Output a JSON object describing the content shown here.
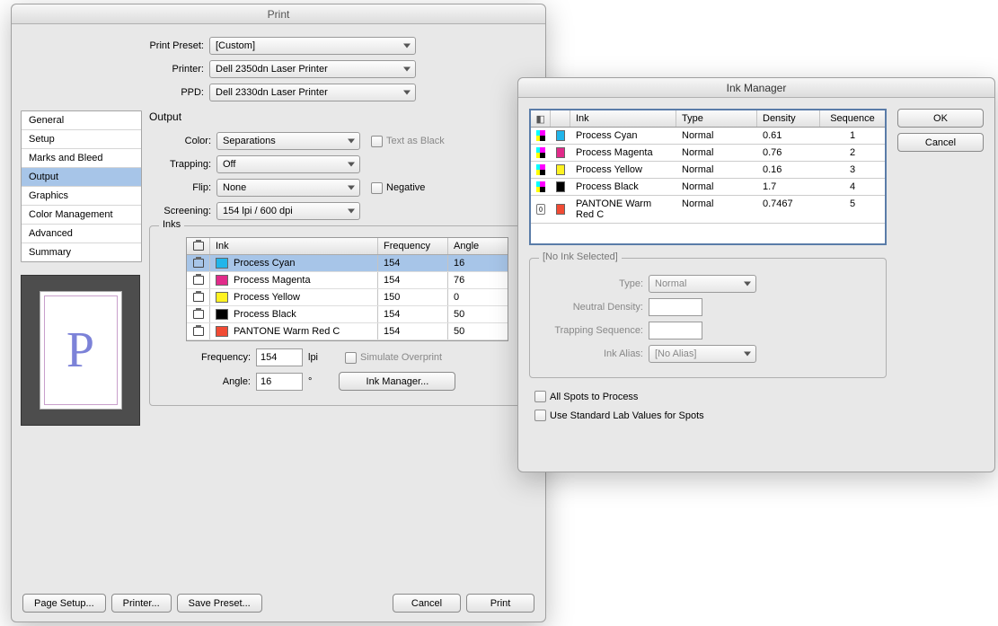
{
  "print": {
    "title": "Print",
    "preset_label": "Print Preset:",
    "preset_value": "[Custom]",
    "printer_label": "Printer:",
    "printer_value": "Dell 2350dn Laser Printer",
    "ppd_label": "PPD:",
    "ppd_value": "Dell 2330dn Laser Printer",
    "sidebar": [
      "General",
      "Setup",
      "Marks and Bleed",
      "Output",
      "Graphics",
      "Color Management",
      "Advanced",
      "Summary"
    ],
    "selected_index": 3,
    "section_title": "Output",
    "color_label": "Color:",
    "color_value": "Separations",
    "text_as_black": "Text as Black",
    "trapping_label": "Trapping:",
    "trapping_value": "Off",
    "flip_label": "Flip:",
    "flip_value": "None",
    "negative_label": "Negative",
    "screening_label": "Screening:",
    "screening_value": "154 lpi / 600 dpi",
    "inks_legend": "Inks",
    "headers": {
      "ink": "Ink",
      "freq": "Frequency",
      "angle": "Angle"
    },
    "rows": [
      {
        "name": "Process Cyan",
        "swatch": "#21b5ea",
        "freq": "154",
        "angle": "16",
        "selected": true
      },
      {
        "name": "Process Magenta",
        "swatch": "#e12b8a",
        "freq": "154",
        "angle": "76",
        "selected": false
      },
      {
        "name": "Process Yellow",
        "swatch": "#fff221",
        "freq": "150",
        "angle": "0",
        "selected": false
      },
      {
        "name": "Process Black",
        "swatch": "#000000",
        "freq": "154",
        "angle": "50",
        "selected": false
      },
      {
        "name": "PANTONE Warm Red C",
        "swatch": "#f14b34",
        "freq": "154",
        "angle": "50",
        "selected": false
      }
    ],
    "freq_label": "Frequency:",
    "freq_value": "154",
    "freq_unit": "lpi",
    "angle_label": "Angle:",
    "angle_value": "16",
    "angle_unit": "°",
    "simulate_overprint": "Simulate Overprint",
    "ink_manager_btn": "Ink Manager...",
    "footer": {
      "page_setup": "Page Setup...",
      "printer": "Printer...",
      "save_preset": "Save Preset...",
      "cancel": "Cancel",
      "print": "Print"
    },
    "preview_glyph": "P"
  },
  "ink_manager": {
    "title": "Ink Manager",
    "ok": "OK",
    "cancel": "Cancel",
    "headers": {
      "ink": "Ink",
      "type": "Type",
      "density": "Density",
      "sequence": "Sequence"
    },
    "rows": [
      {
        "name": "Process Cyan",
        "swatch": "#21b5ea",
        "type": "Normal",
        "density": "0.61",
        "seq": "1",
        "kind": "process"
      },
      {
        "name": "Process Magenta",
        "swatch": "#e12b8a",
        "type": "Normal",
        "density": "0.76",
        "seq": "2",
        "kind": "process"
      },
      {
        "name": "Process Yellow",
        "swatch": "#fff221",
        "type": "Normal",
        "density": "0.16",
        "seq": "3",
        "kind": "process"
      },
      {
        "name": "Process Black",
        "swatch": "#000000",
        "type": "Normal",
        "density": "1.7",
        "seq": "4",
        "kind": "process"
      },
      {
        "name": "PANTONE Warm Red C",
        "swatch": "#f14b34",
        "type": "Normal",
        "density": "0.7467",
        "seq": "5",
        "kind": "spot"
      }
    ],
    "none_selected": "[No Ink Selected]",
    "type_label": "Type:",
    "type_value": "Normal",
    "nd_label": "Neutral Density:",
    "ts_label": "Trapping Sequence:",
    "alias_label": "Ink Alias:",
    "alias_value": "[No Alias]",
    "all_spots": "All Spots to Process",
    "standard_lab": "Use Standard Lab Values for Spots"
  }
}
